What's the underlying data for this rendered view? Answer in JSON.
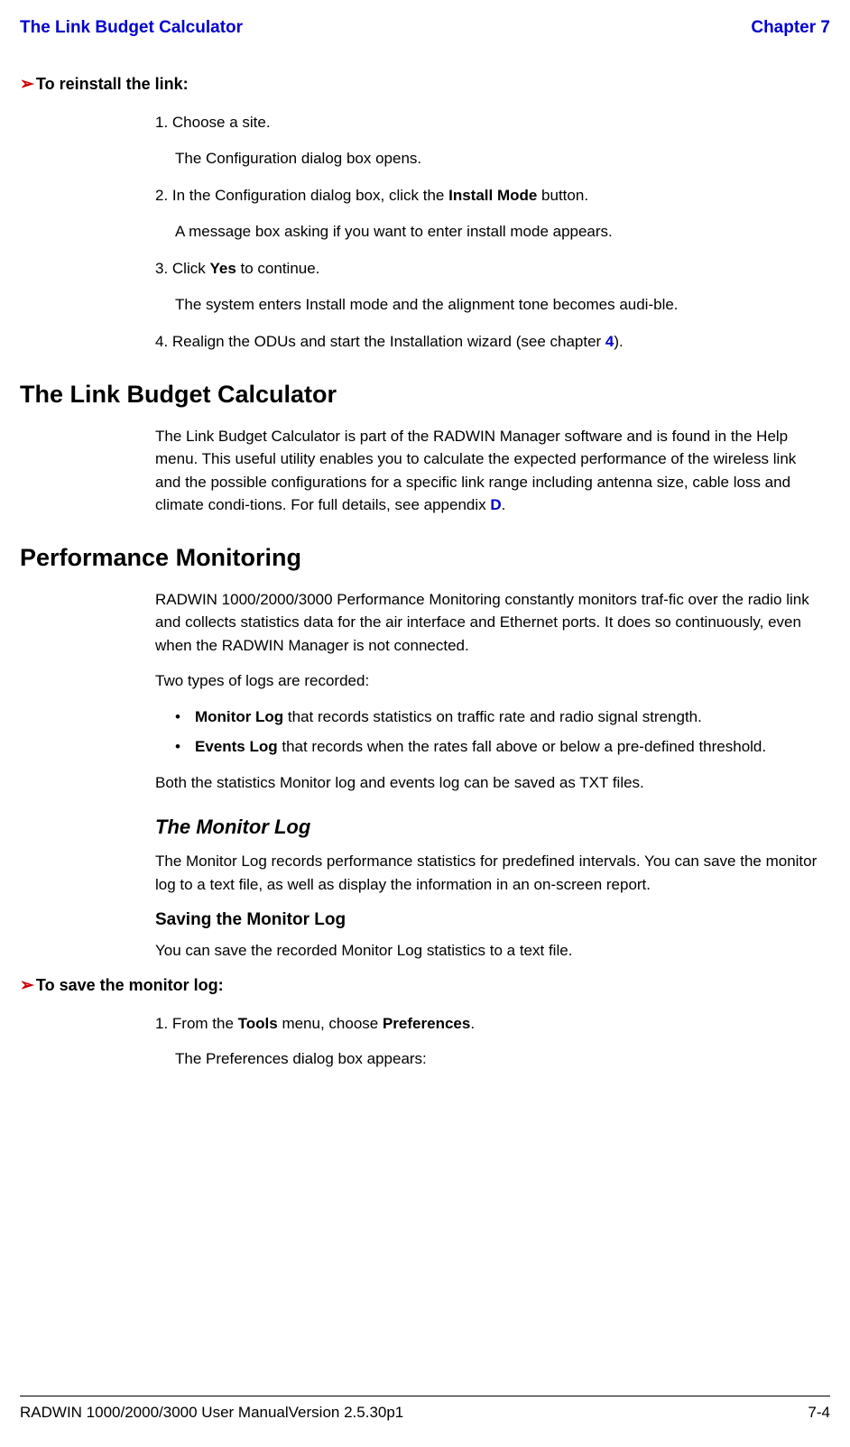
{
  "header": {
    "left": "The Link Budget Calculator",
    "right": "Chapter 7"
  },
  "proc1": {
    "title": "To reinstall the link:",
    "s1": "1. Choose a site.",
    "s1r": "The Configuration dialog box opens.",
    "s2a": "2. In the Configuration dialog box, click the ",
    "s2b": "Install Mode",
    "s2c": " button.",
    "s2r": "A message box asking if you want to enter install mode appears.",
    "s3a": "3. Click ",
    "s3b": "Yes",
    "s3c": " to continue.",
    "s3r": "The system enters Install mode and the alignment tone becomes audi-ble.",
    "s4a": "4. Realign the ODUs and start the Installation wizard (see chapter ",
    "s4b": "4",
    "s4c": ")."
  },
  "sec1": {
    "title": "The Link Budget Calculator",
    "pA": "The Link Budget Calculator is part of the RADWIN Manager software and is found in the Help menu. This useful utility enables you to calculate the expected performance of the wireless link and the possible configurations for a specific link range including antenna size, cable loss and climate condi-tions. For full details, see appendix ",
    "pB": "D",
    "pC": "."
  },
  "sec2": {
    "title": "Performance Monitoring",
    "p1": "RADWIN 1000/2000/3000 Performance Monitoring constantly monitors traf-fic over the radio link and collects statistics data for the air interface and Ethernet ports. It does so continuously, even when the RADWIN Manager is not connected.",
    "p2": "Two types of logs are recorded:",
    "b1a": "Monitor Log",
    "b1b": " that records statistics on traffic rate and radio signal strength.",
    "b2a": "Events Log",
    "b2b": " that records when the rates fall above or below a pre-defined threshold.",
    "p3": "Both the statistics Monitor log and events log can be saved as TXT files.",
    "sub": {
      "title": "The Monitor Log",
      "p1": "The Monitor Log records performance statistics for predefined intervals. You can save the monitor log to a text file, as well as display the information in an on-screen report.",
      "h3": "Saving the Monitor Log",
      "p2": "You can save the recorded Monitor Log statistics to a text file."
    }
  },
  "proc2": {
    "title": "To save the monitor log:",
    "s1a": "1. From the ",
    "s1b": "Tools",
    "s1c": " menu, choose ",
    "s1d": "Preferences",
    "s1e": ".",
    "s1r": "The Preferences dialog box appears:"
  },
  "footer": {
    "left": "RADWIN 1000/2000/3000 User ManualVersion  2.5.30p1",
    "right": "7-4"
  }
}
